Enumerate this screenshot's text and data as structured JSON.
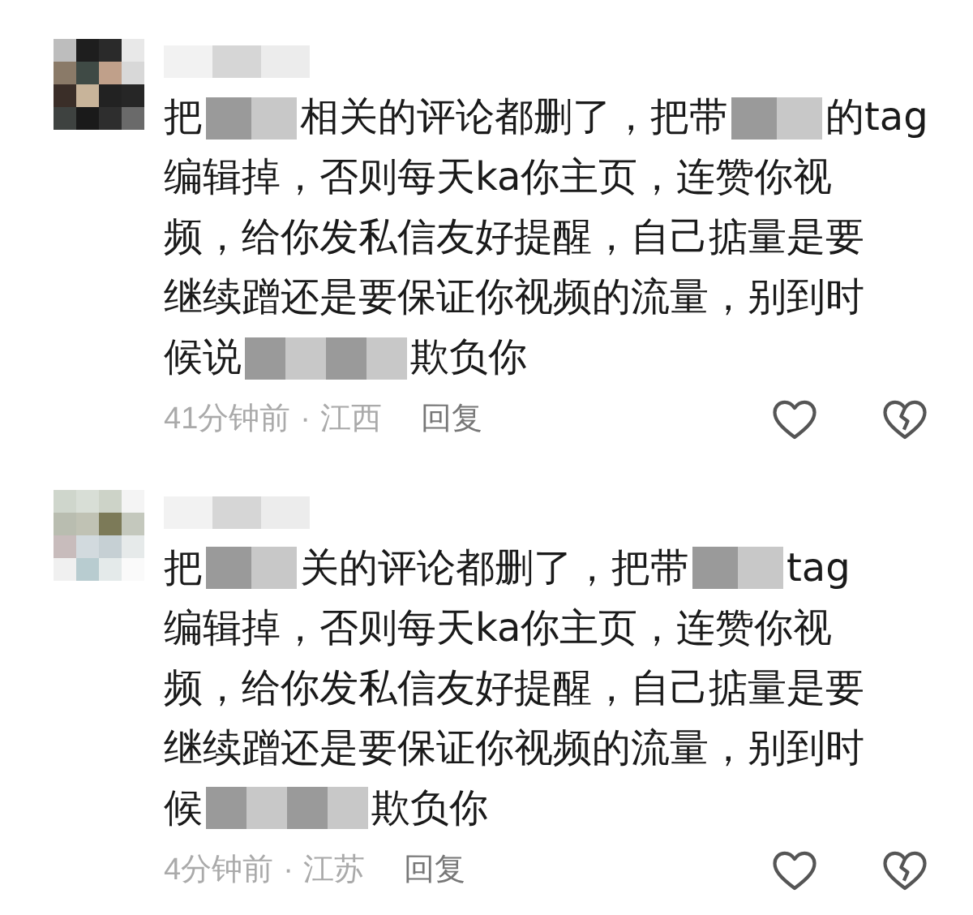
{
  "comments": [
    {
      "lines": [
        [
          {
            "kind": "text",
            "text": "把"
          },
          {
            "kind": "redacted"
          },
          {
            "kind": "text",
            "text": "相关的评论都删了，把带"
          },
          {
            "kind": "redacted"
          },
          {
            "kind": "text",
            "text": "的tag"
          }
        ],
        [
          {
            "kind": "text",
            "text": "编辑掉，否则每天ka你主页，连赞你视"
          }
        ],
        [
          {
            "kind": "text",
            "text": "频，给你发私信友好提醒，自己掂量是要"
          }
        ],
        [
          {
            "kind": "text",
            "text": "继续蹭还是要保证你视频的流量，别到时"
          }
        ],
        [
          {
            "kind": "text",
            "text": "候说"
          },
          {
            "kind": "redacted"
          },
          {
            "kind": "text",
            "text": "欺负你"
          }
        ]
      ],
      "time": "41分钟前",
      "separator": "·",
      "location": "江西",
      "reply": "回复"
    },
    {
      "lines": [
        [
          {
            "kind": "text",
            "text": "把"
          },
          {
            "kind": "redacted"
          },
          {
            "kind": "text",
            "text": "关的评论都删了，把带"
          },
          {
            "kind": "redacted"
          },
          {
            "kind": "text",
            "text": "tag"
          }
        ],
        [
          {
            "kind": "text",
            "text": "编辑掉，否则每天ka你主页，连赞你视"
          }
        ],
        [
          {
            "kind": "text",
            "text": "频，给你发私信友好提醒，自己掂量是要"
          }
        ],
        [
          {
            "kind": "text",
            "text": "继续蹭还是要保证你视频的流量，别到时"
          }
        ],
        [
          {
            "kind": "text",
            "text": "候"
          },
          {
            "kind": "redacted"
          },
          {
            "kind": "text",
            "text": "欺负你"
          }
        ]
      ],
      "time": "4分钟前",
      "separator": "·",
      "location": "江苏",
      "reply": "回复"
    }
  ]
}
